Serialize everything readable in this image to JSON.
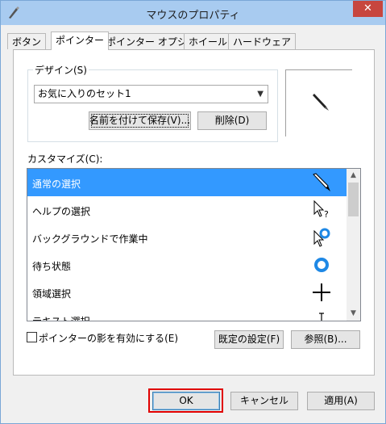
{
  "window": {
    "title": "マウスのプロパティ",
    "close_label": "✕"
  },
  "tabs": [
    {
      "label": "ボタン"
    },
    {
      "label": "ポインター"
    },
    {
      "label": "ポインター オプション"
    },
    {
      "label": "ホイール"
    },
    {
      "label": "ハードウェア"
    }
  ],
  "design": {
    "label": "デザイン(S)",
    "selected": "お気に入りのセット1",
    "save_button": "名前を付けて保存(V)...",
    "delete_button": "削除(D)"
  },
  "customize": {
    "label": "カスタマイズ(C):",
    "items": [
      {
        "label": "通常の選択",
        "cursor": "pen-icon",
        "selected": true
      },
      {
        "label": "ヘルプの選択",
        "cursor": "help-select-icon",
        "selected": false
      },
      {
        "label": "バックグラウンドで作業中",
        "cursor": "working-in-background-icon",
        "selected": false
      },
      {
        "label": "待ち状態",
        "cursor": "busy-ring-icon",
        "selected": false
      },
      {
        "label": "領域選択",
        "cursor": "crosshair-icon",
        "selected": false
      },
      {
        "label": "テキスト選択",
        "cursor": "text-beam-icon",
        "selected": false
      }
    ]
  },
  "shadow_checkbox": {
    "label": "ポインターの影を有効にする(E)",
    "checked": false
  },
  "default_button": "既定の設定(F)",
  "browse_button": "参照(B)...",
  "footer": {
    "ok": "OK",
    "cancel": "キャンセル",
    "apply": "適用(A)"
  },
  "colors": {
    "selection": "#3399ff",
    "highlight": "#e00000",
    "titlebar": "#a8cbf0"
  }
}
